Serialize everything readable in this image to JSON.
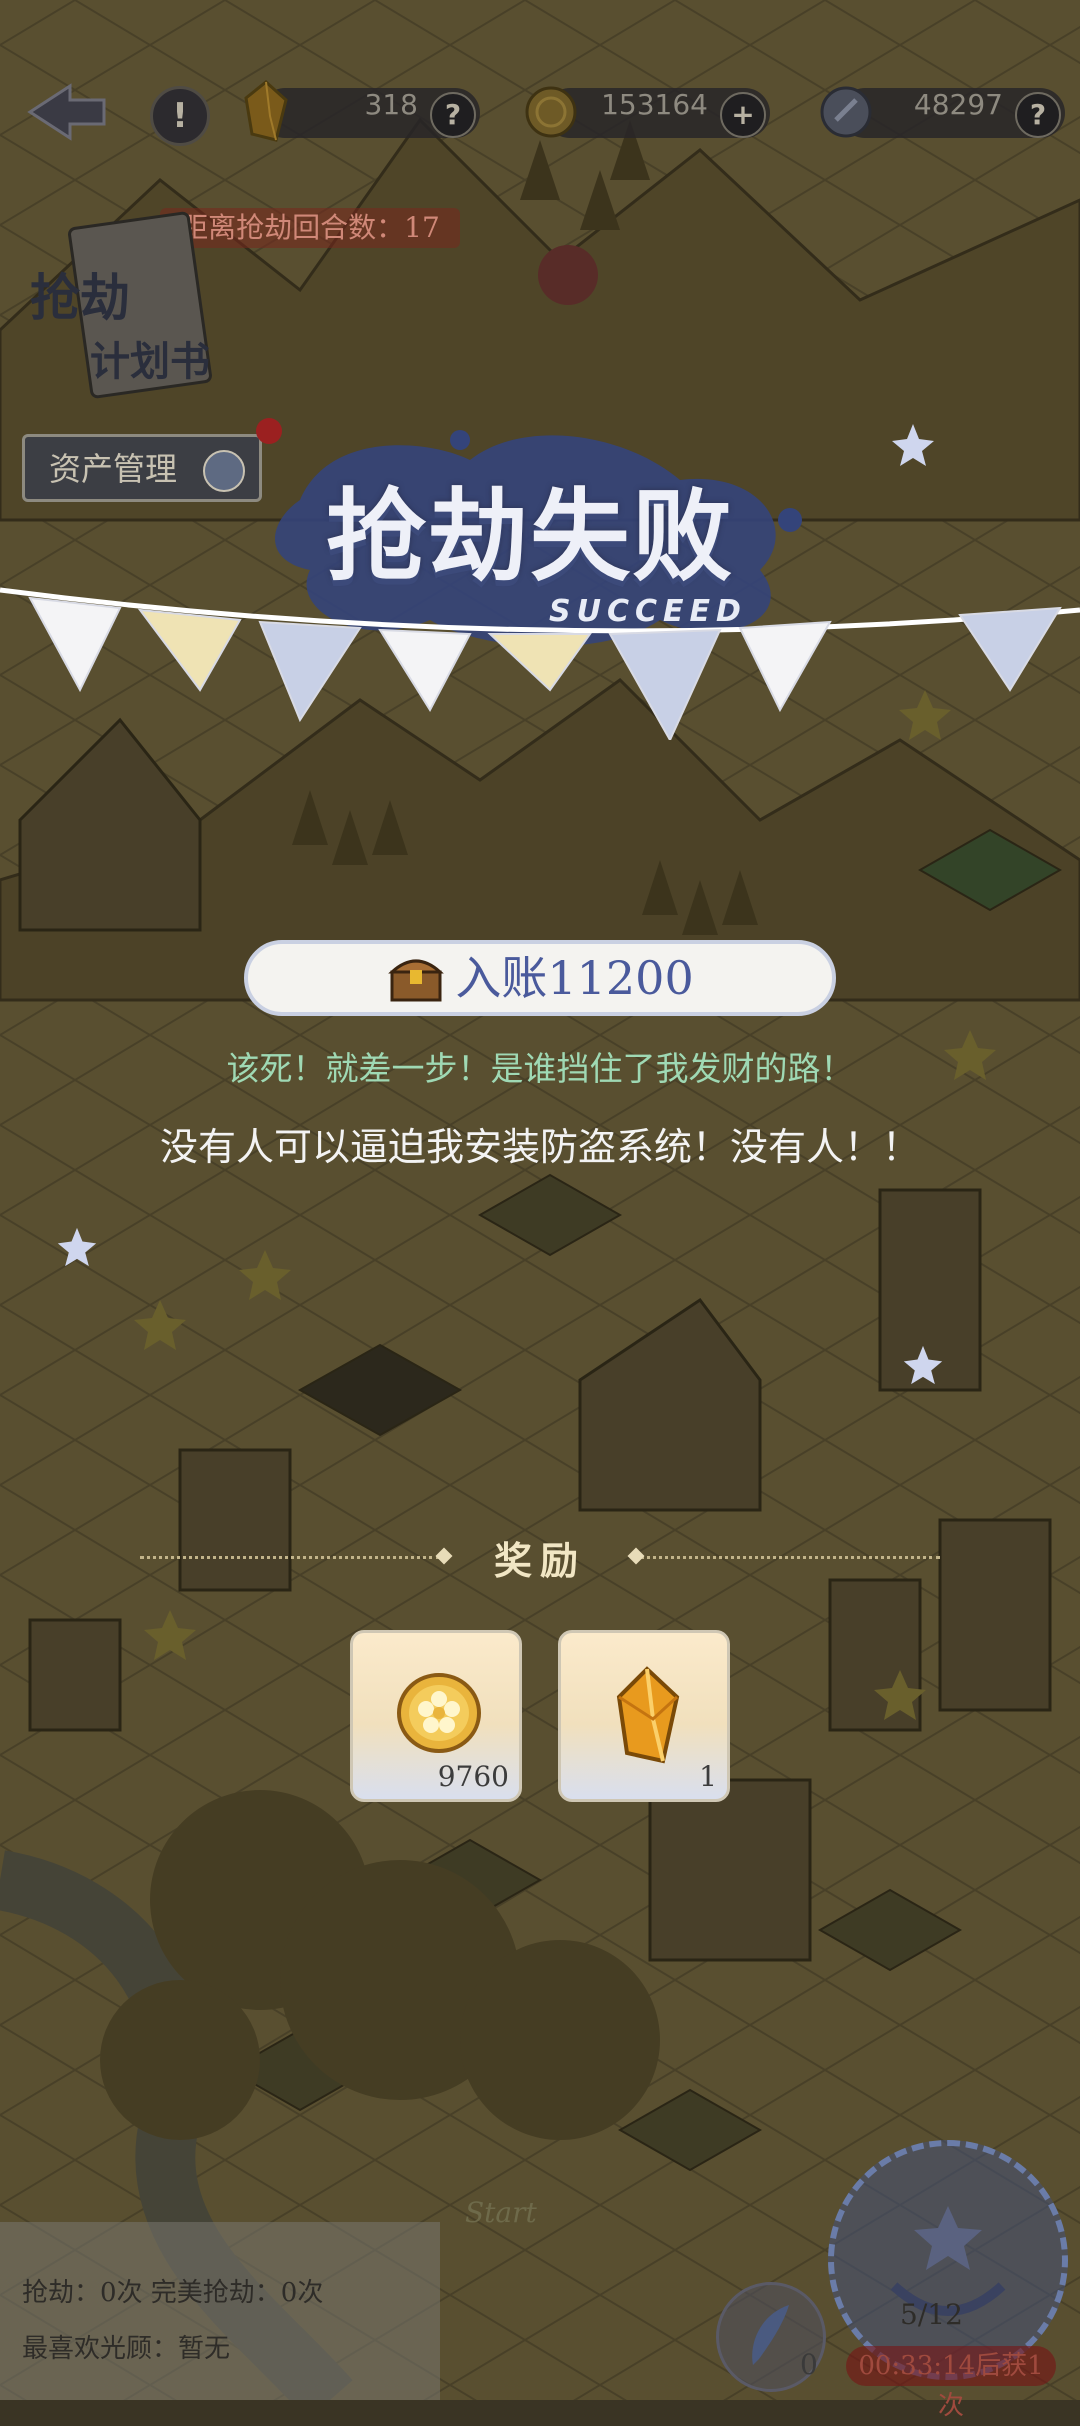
{
  "topbar": {
    "gems": "318",
    "coins": "153164",
    "silver": "48297",
    "help_icon": "question-mark-icon",
    "add_icon": "plus-icon"
  },
  "countdown_text": "距离抢劫回合数：17",
  "plan_book": {
    "line1": "抢劫",
    "line2": "计划书"
  },
  "asset_button": "资产管理",
  "result": {
    "title": "抢劫失败",
    "subtitle": "SUCCEED",
    "income_label": "入账11200"
  },
  "quotes": {
    "line1": "该死！就差一步！是谁挡住了我发财的路！",
    "line2": "没有人可以逼迫我安装防盗系统！没有人！！"
  },
  "reward": {
    "title": "奖励",
    "items": [
      {
        "icon": "gold-coin-icon",
        "qty": "9760"
      },
      {
        "icon": "amber-gem-icon",
        "qty": "1"
      }
    ]
  },
  "stats": {
    "line1": "抢劫：0次  完美抢劫：0次",
    "line2": "最喜欢光顾：暂无"
  },
  "bottom": {
    "feather_count": "0",
    "progress": "5/12",
    "timer": "00:33:14后获1次",
    "start_label": "Start"
  },
  "colors": {
    "income_text": "#4a5a9c",
    "quote1": "#9fd9b4",
    "quote2": "#f3f3f3",
    "reward_title": "#f1e6c4"
  }
}
